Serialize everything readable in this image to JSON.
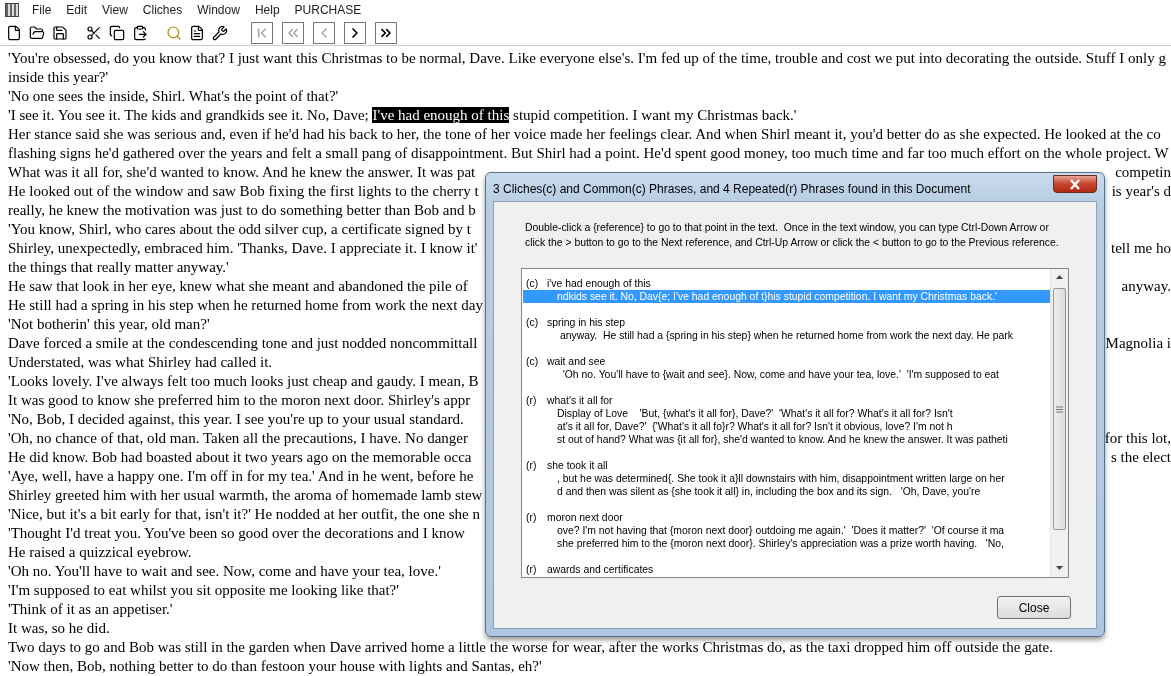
{
  "menu_bar": {
    "items": [
      "File",
      "Edit",
      "View",
      "Cliches",
      "Window",
      "Help",
      "PURCHASE"
    ]
  },
  "toolbar": {
    "groups": [
      [
        {
          "kind": "new",
          "disabled": false
        },
        {
          "kind": "open",
          "disabled": false
        },
        {
          "kind": "save",
          "disabled": false
        }
      ],
      [
        {
          "kind": "cut",
          "disabled": false
        },
        {
          "kind": "copy",
          "disabled": false
        },
        {
          "kind": "paste",
          "disabled": false
        }
      ],
      [
        {
          "kind": "find",
          "disabled": false
        },
        {
          "kind": "report",
          "disabled": false
        },
        {
          "kind": "settings",
          "disabled": false
        }
      ],
      [
        {
          "kind": "first",
          "disabled": true
        },
        {
          "kind": "back_many",
          "disabled": true
        },
        {
          "kind": "previous",
          "disabled": true
        },
        {
          "kind": "next",
          "disabled": false
        },
        {
          "kind": "forward_many",
          "disabled": false
        }
      ]
    ]
  },
  "document": {
    "lines": [
      {
        "text": "'You're obsessed, do you know that? I just want this Christmas to be normal, Dave. Like everyone else's. I'm fed up of the time, trouble and cost we put into decorating the outside. Stuff I only g"
      },
      {
        "text": "inside this year?'"
      },
      {
        "text": "'No one sees the inside, Shirl. What's the point of that?'"
      },
      {
        "text": "'I see it. You see it. The kids and grandkids see it. No, Dave; ",
        "selected_text": "I've had enough of this",
        "text_after": " stupid competition. I want my Christmas back.'"
      },
      {
        "text": "Her stance said she was serious and, even if he'd had his back to her, the tone of her voice made her feelings clear. And when Shirl meant it, you'd better do as she expected. He looked at the co"
      },
      {
        "text": "flashing signs he'd gathered over the years and felt a small pang of disappointment. But Shirl had a point. He'd spent good money, too much time and far too much effort on the whole project. W"
      },
      {
        "text": "What was it all for, she'd wanted to know. And he knew the answer. It was pat",
        "right": "competin"
      },
      {
        "text": "He looked out of the window and saw Bob fixing the first lights to the cherry t",
        "right": "is year's d"
      },
      {
        "text": "really, he knew the motivation was just to do something better than Bob and b"
      },
      {
        "text": "'You know, Shirl, who cares about the odd silver cup, a certificate signed by t"
      },
      {
        "text": "Shirley, unexpectedly, embraced him. 'Thanks, Dave. I appreciate it. I know it'",
        "right": "tell me ho"
      },
      {
        "text": "the things that really matter anyway.'"
      },
      {
        "text": "He saw that look in her eye, knew what she meant and abandoned the pile of",
        "right": "anyway."
      },
      {
        "text": "He still had a spring in his step when he returned home from work the next day"
      },
      {
        "text": "'Not botherin' this year, old man?'"
      },
      {
        "text": "Dave forced a smile at the condescending tone and just nodded noncommittall",
        "right": "Magnolia i"
      },
      {
        "text": "Understated, was what Shirley had called it."
      },
      {
        "text": "'Looks lovely. I've always felt too much looks just cheap and gaudy. I mean, B"
      },
      {
        "text": "It was good to know she preferred him to the moron next door. Shirley's appr"
      },
      {
        "text": "'No, Bob, I decided against, this year. I see you're up to your usual standard."
      },
      {
        "text": "'Oh, no chance of that, old man. Taken all the precautions, I have. No danger",
        "right": "for this lot,"
      },
      {
        "text": "He did know. Bob had boasted about it two years ago on the memorable occa",
        "right": "s the elect"
      },
      {
        "text": "'Aye, well, have a happy one. I'm off in for my tea.' And in he went, before he"
      },
      {
        "text": "Shirley greeted him with her usual warmth, the aroma of homemade lamb stew"
      },
      {
        "text": "'Nice, but it's a bit early for that, isn't it?' He nodded at her outfit, the one she n"
      },
      {
        "text": "'Thought I'd treat you. You've been so good over the decorations and I know"
      },
      {
        "text": "He raised a quizzical eyebrow."
      },
      {
        "text": "'Oh no. You'll have to wait and see. Now, come and have your tea, love.'"
      },
      {
        "text": "'I'm supposed to eat whilst you sit opposite me looking like that?'"
      },
      {
        "text": "'Think of it as an appetiser.'"
      },
      {
        "text": "It was, so he did."
      },
      {
        "text": "Two days to go and Bob was still in the garden when Dave arrived home a little the worse for wear, after the works Christmas do, as the taxi dropped him off outside the gate."
      },
      {
        "text": "'Now then, Bob, nothing better to do than festoon your house with lights and Santas, eh?'"
      }
    ]
  },
  "dialog": {
    "title": "3 Cliches(c) and Common(c) Phrases, and 4 Repeated(r) Phrases found in this Document",
    "instructions": "Double-click a {reference} to go to that point in the text.  Once in the text window, you can type Ctrl-Down Arrow or click the > button to go to the Next reference, and Ctrl-Up Arrow or click the < button to go to the Previous reference.",
    "results": [
      {
        "code": "(c)",
        "phrase": "i've had enough of this",
        "contexts": [
          {
            "text": "ndkids see it. No, Dav{e; I've had enough of t}his stupid competition. I want my Christmas back.'",
            "selected": true
          }
        ]
      },
      {
        "code": "(c)",
        "phrase": "spring in his step",
        "contexts": [
          {
            "text": " anyway.  He still had a {spring in his step} when he returned home from work the next day. He park",
            "selected": false
          }
        ]
      },
      {
        "code": "(c)",
        "phrase": "wait and see",
        "contexts": [
          {
            "text": "  'Oh no. You'll have to {wait and see}. Now, come and have your tea, love.'  'I'm supposed to eat",
            "selected": false
          }
        ]
      },
      {
        "code": "(r)",
        "phrase": "what's it all for",
        "contexts": [
          {
            "text": "Display of Love    'But, {what's it all for}, Dave?'  'What's it all for? What's it all for? Isn't",
            "selected": false
          },
          {
            "text": "at's it all for, Dave?'  {'What's it all fo}r? What's it all for? Isn't it obvious, love? I'm not h",
            "selected": false
          },
          {
            "text": "st out of hand? What was {it all for}, she'd wanted to know. And he knew the answer. It was patheti",
            "selected": false
          }
        ]
      },
      {
        "code": "(r)",
        "phrase": "she took it all",
        "contexts": [
          {
            "text": ", but he was determined{. She took it a}ll downstairs with him, disappointment written large on her",
            "selected": false
          },
          {
            "text": "d and then was silent as {she took it all} in, including the box and its sign.   'Oh, Dave, you're",
            "selected": false
          }
        ]
      },
      {
        "code": "(r)",
        "phrase": "moron next door",
        "contexts": [
          {
            "text": "ove? I'm not having that {moron next door} outdoing me again.'  'Does it matter?'  'Of course it ma",
            "selected": false
          },
          {
            "text": "she preferred him to the {moron next door}. Shirley's appreciation was a prize worth having.   'No,",
            "selected": false
          }
        ]
      },
      {
        "code": "(r)",
        "phrase": "awards and certificates"
      }
    ],
    "buttons": [
      "Close"
    ]
  }
}
